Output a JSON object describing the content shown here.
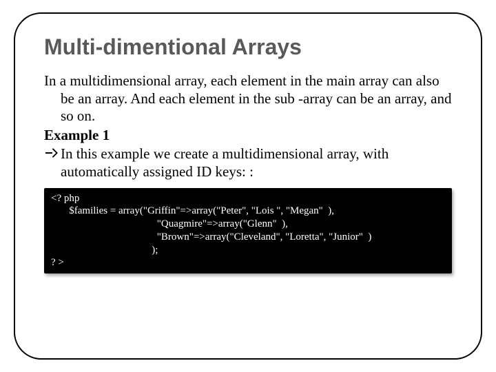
{
  "title": "Multi-dimentional Arrays",
  "body": {
    "intro": "In a multidimensional array, each element in the main array can also be an array. And each element in the sub -array can be an array, and so on.",
    "example_label": "Example 1",
    "bullet_text": "In this example we create a multidimensional array, with automatically assigned ID keys: :"
  },
  "code": {
    "l1": "<? php",
    "l2": "       $families = array(\"Griffin\"=>array(\"Peter\", \"Lois \", \"Megan\"  ),",
    "l3": "                                         \"Quagmire\"=>array(\"Glenn\"  ),",
    "l4": "                                         \"Brown\"=>array(\"Cleveland\", \"Loretta\", \"Junior\"  )",
    "l5": "                                       );",
    "l6": "? >"
  }
}
